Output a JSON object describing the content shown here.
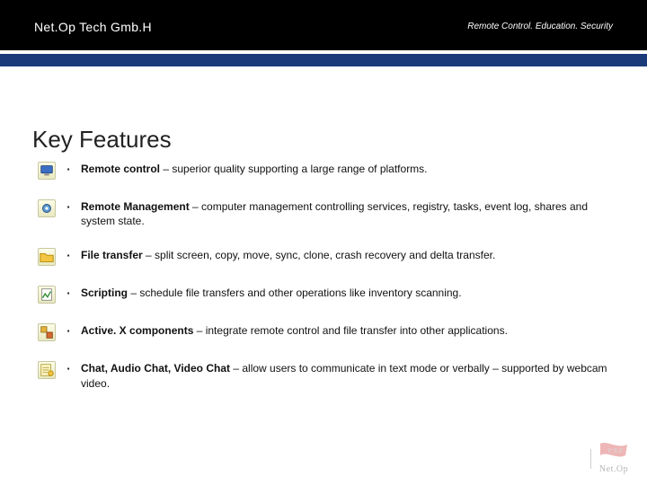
{
  "header": {
    "company": "Net.Op Tech Gmb.H",
    "tagline": "Remote Control. Education. Security"
  },
  "title": "Key Features",
  "features": [
    {
      "icon": "monitor-icon",
      "bold": "Remote control",
      "rest": " – superior quality supporting a large range of platforms."
    },
    {
      "icon": "gear-icon",
      "bold": "Remote Management",
      "rest": " – computer management controlling  services, registry, tasks, event log, shares and system state."
    },
    {
      "icon": "folder-icon",
      "bold": "File transfer",
      "rest": " – split screen, copy, move, sync, clone, crash recovery and delta transfer."
    },
    {
      "icon": "script-icon",
      "bold": "Scripting",
      "rest": " – schedule file transfers and other operations like inventory scanning."
    },
    {
      "icon": "component-icon",
      "bold": "Active. X components",
      "rest": " – integrate remote control and file transfer into other applications."
    },
    {
      "icon": "chat-icon",
      "bold": "Chat, Audio Chat, Video Chat",
      "rest": " – allow users to communicate in text mode or verbally – supported by webcam video."
    }
  ],
  "footer": {
    "brand": "Net.Op"
  }
}
